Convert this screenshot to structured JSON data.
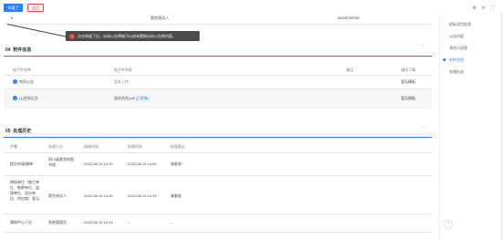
{
  "toolbar": {
    "primary_label": "知道了",
    "secondary_label": "返回"
  },
  "top_row": {
    "index": "5",
    "name": "奥克测试八",
    "phone": "15298789780"
  },
  "tooltip": {
    "badge": "!",
    "text": "点击知道了后，自动公告将被可以成本替换自动公告例内容。"
  },
  "attachments": {
    "number": "04",
    "title": "附件信息",
    "headers": [
      "电子件名称",
      "电子件列表",
      "备注",
      "操作下载"
    ],
    "rows": [
      {
        "name": "合同公告",
        "file": "暂未上传",
        "note": "",
        "action": "暂无模板"
      },
      {
        "name": "(1)合同正文",
        "file": "测试合同.pdf",
        "file_tag": "[已签章]",
        "note": "",
        "action": "暂无模板"
      }
    ]
  },
  "history": {
    "number": "05",
    "title": "处理历史",
    "headers": [
      "步骤",
      "办理人员",
      "接收时间",
      "处理时间",
      "处理意见"
    ],
    "rows": [
      {
        "step": "提交申请/撤单",
        "person": "四川省奥克的图书馆",
        "received": "2022-08-19 14:25",
        "handled": "2022-08-19 14:05",
        "opinion": "请查收！"
      },
      {
        "step": "审核单位（施工单位、勘察单位、监理单位、设计单位、供应商）意见",
        "person": "奥克测试八",
        "received": "2022-08-19 14:25",
        "handled": "2022-08-19 14:33",
        "opinion": "请查收"
      },
      {
        "step": "通知中心人员",
        "person": "系统管理员",
        "received": "2022-08-19 14:33",
        "handled": "--",
        "opinion": "--"
      }
    ]
  },
  "sidebar": {
    "items": [
      {
        "label": "招标项目信息",
        "active": false
      },
      {
        "label": "公告内容",
        "active": false
      },
      {
        "label": "承包人信息",
        "active": false
      },
      {
        "label": "附件信息",
        "active": true
      },
      {
        "label": "处理历史",
        "active": false
      }
    ]
  },
  "icons": {
    "top_right": [
      "settings-icon",
      "refresh-icon",
      "fullscreen-icon"
    ],
    "scroll_top": "arrow-up-icon"
  },
  "colors": {
    "accent": "#2f7ef6",
    "danger": "#e04a3a"
  }
}
